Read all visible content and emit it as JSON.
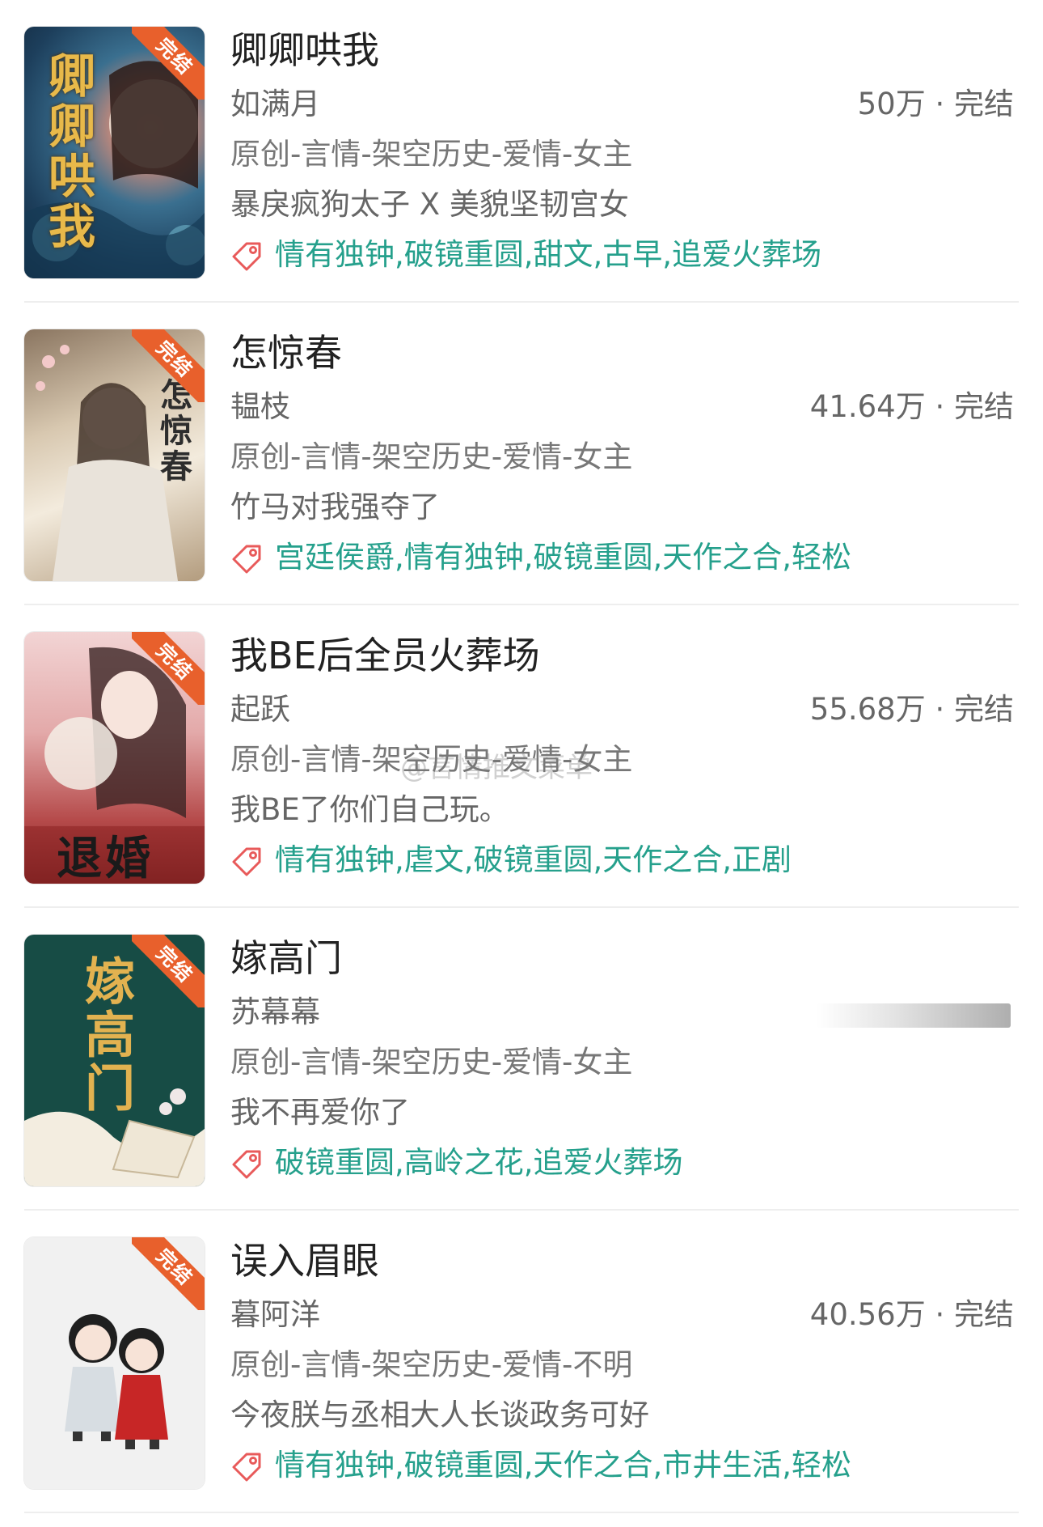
{
  "books": [
    {
      "title": "卿卿哄我",
      "author": "如满月",
      "stats": "50万 · 完结",
      "category": "原创-言情-架空历史-爱情-女主",
      "intro": "暴戾疯狗太子 X 美貌坚韧宫女",
      "tags": "情有独钟,破镜重圆,甜文,古早,追爱火葬场",
      "ribbon": "完结",
      "cover_text": "卿卿哄我"
    },
    {
      "title": "怎惊春",
      "author": "韫枝",
      "stats": "41.64万 · 完结",
      "category": "原创-言情-架空历史-爱情-女主",
      "intro": "竹马对我强夺了",
      "tags": "宫廷侯爵,情有独钟,破镜重圆,天作之合,轻松",
      "ribbon": "完结",
      "cover_text": "怎惊春"
    },
    {
      "title": "我BE后全员火葬场",
      "author": "起跃",
      "stats": "55.68万 · 完结",
      "category": "原创-言情-架空历史-爱情-女主",
      "intro": "我BE了你们自己玩。",
      "tags": "情有独钟,虐文,破镜重圆,天作之合,正剧",
      "ribbon": "完结",
      "cover_text": "退婚"
    },
    {
      "title": "嫁高门",
      "author": "苏幕幕",
      "stats": "",
      "category": "原创-言情-架空历史-爱情-女主",
      "intro": "我不再爱你了",
      "tags": "破镜重圆,高岭之花,追爱火葬场",
      "ribbon": "完结",
      "cover_text": "嫁高门"
    },
    {
      "title": "误入眉眼",
      "author": "暮阿洋",
      "stats": "40.56万 · 完结",
      "category": "原创-言情-架空历史-爱情-不明",
      "intro": "今夜朕与丞相大人长谈政务可好",
      "tags": "情有独钟,破镜重圆,天作之合,市井生活,轻松",
      "ribbon": "完结",
      "cover_text": ""
    }
  ],
  "watermark": "@言情推文菜单",
  "colors": {
    "tag_text": "#25a08c",
    "tag_icon": "#e85a5a",
    "ribbon": "#e8602c",
    "divider": "#eeeeee"
  },
  "icons": {
    "tag": "price-tag-icon"
  }
}
